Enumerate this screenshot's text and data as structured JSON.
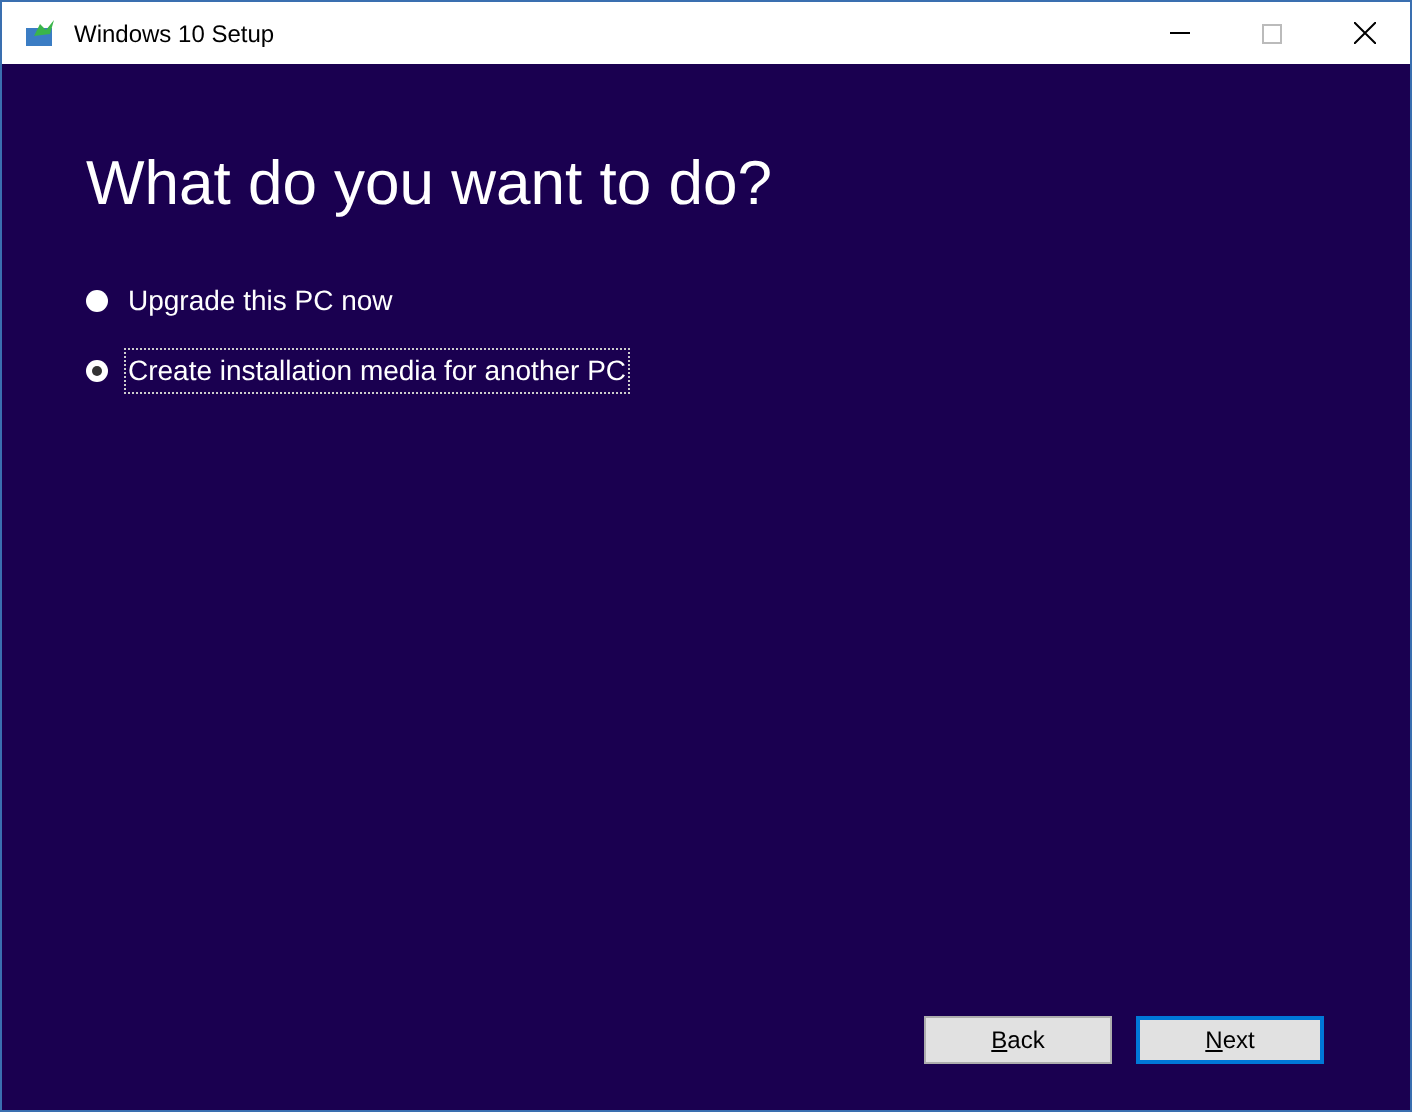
{
  "window": {
    "title": "Windows 10 Setup"
  },
  "heading": "What do you want to do?",
  "options": [
    {
      "label": "Upgrade this PC now",
      "selected": false
    },
    {
      "label": "Create installation media for another PC",
      "selected": true
    }
  ],
  "buttons": [
    {
      "label": "Back",
      "default": false
    },
    {
      "label": "Next",
      "default": true
    }
  ]
}
